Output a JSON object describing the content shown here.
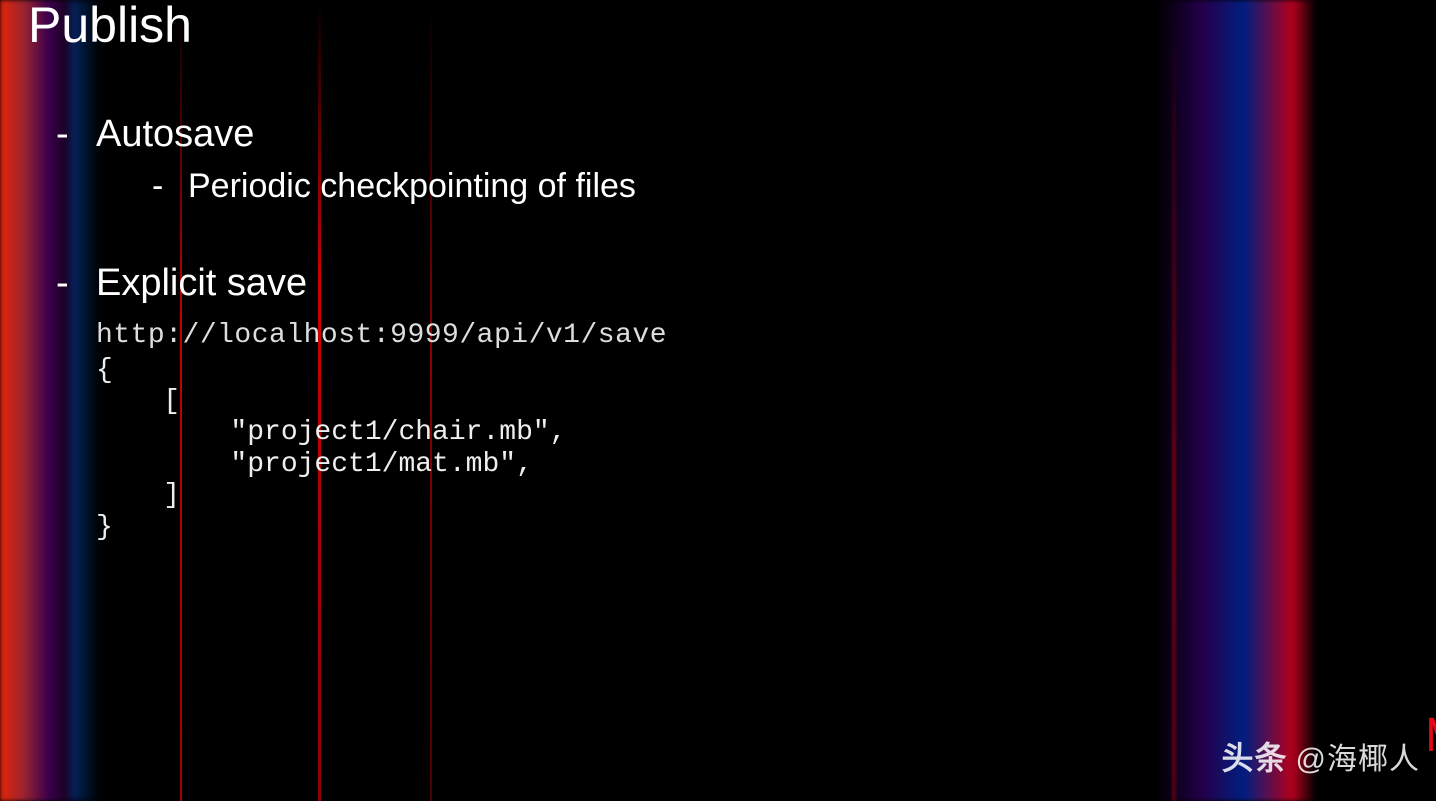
{
  "title": "Publish",
  "bullets": {
    "autosave": {
      "label": "Autosave",
      "sub1": "Periodic checkpointing of files"
    },
    "explicit": {
      "label": "Explicit save",
      "endpoint": "http://localhost:9999/api/v1/save",
      "code": "{\n    [\n        \"project1/chair.mb\",\n        \"project1/mat.mb\",\n    ]\n}"
    }
  },
  "watermark": {
    "brand": "头条",
    "handle": "@海椰人"
  },
  "logo": "N"
}
